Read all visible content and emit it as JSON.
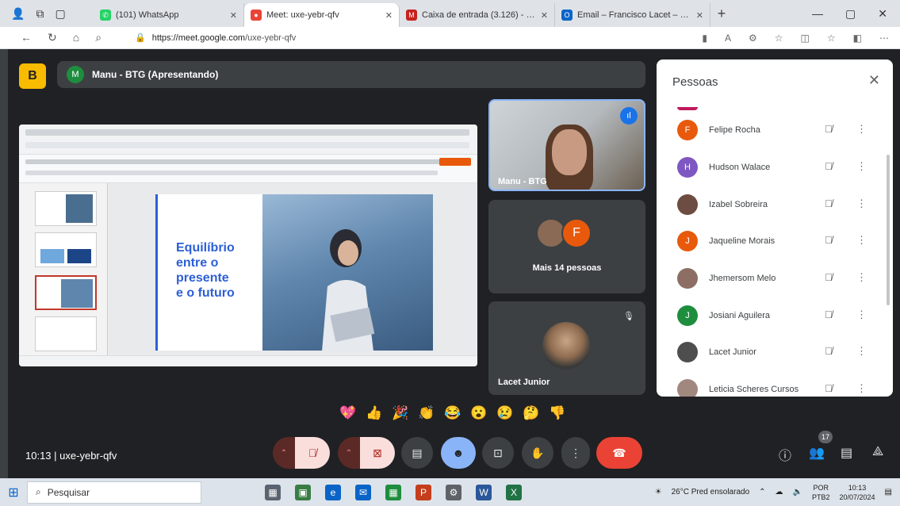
{
  "browser": {
    "tabs": [
      {
        "label": "(101) WhatsApp",
        "icon_color": "#25d366",
        "active": false
      },
      {
        "label": "Meet: uxe-yebr-qfv",
        "icon_color": "#ea4335",
        "active": true
      },
      {
        "label": "Caixa de entrada (3.126) - lacet",
        "icon_color": "#c5221f",
        "active": false
      },
      {
        "label": "Email – Francisco Lacet – Outlook",
        "icon_color": "#0a64c8",
        "active": false
      }
    ],
    "new_tab": "+",
    "url_host": "https://meet.google.com",
    "url_path": "/uxe-yebr-qfv"
  },
  "meet": {
    "logo_letter": "B",
    "presenter_initial": "M",
    "presenter_text": "Manu - BTG (Apresentando)",
    "slide_title_lines": [
      "Equilíbrio",
      "entre o",
      "presente",
      "e o futuro"
    ],
    "tiles": {
      "manu_name": "Manu - BTG",
      "more_initial": "F",
      "more_label": "Mais 14 pessoas",
      "lacet_name": "Lacet Junior"
    },
    "meeting_time": "10:13",
    "meeting_code": "uxe-yebr-qfv",
    "participants_badge": "17"
  },
  "people_panel": {
    "title": "Pessoas",
    "participants": [
      {
        "name": "Felipe Rocha",
        "initial": "F",
        "color": "#e8590c"
      },
      {
        "name": "Hudson Walace",
        "initial": "H",
        "color": "#7e57c2"
      },
      {
        "name": "Izabel Sobreira",
        "initial": "",
        "color": "#6d4c41"
      },
      {
        "name": "Jaqueline Morais",
        "initial": "J",
        "color": "#e8590c"
      },
      {
        "name": "Jhemersom Melo",
        "initial": "",
        "color": "#8d6e63"
      },
      {
        "name": "Josiani Aguilera",
        "initial": "J",
        "color": "#1e8e3e"
      },
      {
        "name": "Lacet Junior",
        "initial": "",
        "color": "#4e4e4e"
      },
      {
        "name": "Leticia Scheres Cursos",
        "initial": "",
        "color": "#a1887f"
      }
    ]
  },
  "reactions": [
    "💖",
    "👍",
    "🎉",
    "👏",
    "😂",
    "😮",
    "😢",
    "🤔",
    "👎"
  ],
  "taskbar": {
    "search_placeholder": "Pesquisar",
    "weather": "26°C  Pred ensolarado",
    "lang": "POR",
    "lang2": "PTB2",
    "time": "10:13",
    "date": "20/07/2024"
  }
}
